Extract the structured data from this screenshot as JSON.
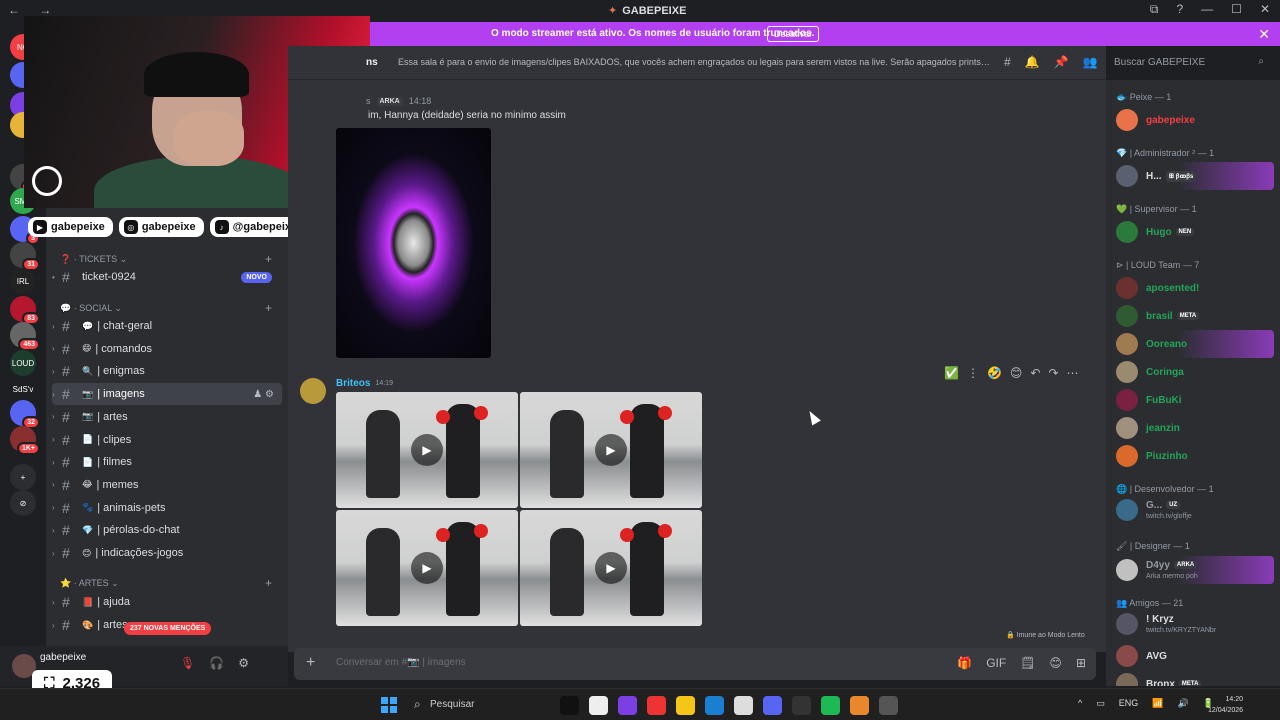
{
  "window": {
    "title": "GABEPEIXE",
    "controls": [
      "⧉",
      "?",
      "—",
      "☐",
      "✕"
    ],
    "nav": "← →"
  },
  "banner": {
    "text": "O modo streamer está ativo. Os nomes de usuário foram truncados.",
    "button": "Desativar",
    "close": "✕"
  },
  "rail": {
    "servers": [
      {
        "label": "NO",
        "badge": ""
      },
      {
        "label": "",
        "badge": "1"
      },
      {
        "label": "",
        "badge": "2"
      },
      {
        "label": "",
        "badge": ""
      },
      {
        "label": "",
        "badge": "4K"
      },
      {
        "label": "SMP",
        "badge": ""
      },
      {
        "label": "",
        "badge": "3"
      },
      {
        "label": "",
        "badge": "31"
      },
      {
        "label": "IRL",
        "badge": ""
      },
      {
        "label": "",
        "badge": "83"
      },
      {
        "label": "",
        "badge": "463"
      },
      {
        "label": "LOUD",
        "badge": ""
      },
      {
        "label": "SdS'v",
        "badge": ""
      },
      {
        "label": "",
        "badge": "32"
      },
      {
        "label": "",
        "badge": "1K+"
      },
      {
        "label": "+",
        "badge": ""
      },
      {
        "label": "⊘",
        "badge": ""
      }
    ]
  },
  "socials": [
    {
      "icon": "▶",
      "label": "gabepeixe"
    },
    {
      "icon": "◎",
      "label": "gabepeixe"
    },
    {
      "icon": "♪",
      "label": "@gabepeixes2"
    }
  ],
  "sidebar": {
    "categories": [
      {
        "label": "TICKETS",
        "emoji": "❓"
      },
      {
        "label": "SOCIAL",
        "emoji": "💬"
      },
      {
        "label": "ARTES",
        "emoji": "⭐"
      }
    ],
    "channels": [
      {
        "emoji": "",
        "name": "ticket-0924",
        "tag": "NOVO"
      },
      {
        "emoji": "💬",
        "name": "| chat-geral",
        "tag": ""
      },
      {
        "emoji": "😄",
        "name": "| comandos",
        "tag": ""
      },
      {
        "emoji": "🔍",
        "name": "| enigmas",
        "tag": ""
      },
      {
        "emoji": "📷",
        "name": "| imagens",
        "tag": ""
      },
      {
        "emoji": "📷",
        "name": "| artes",
        "tag": ""
      },
      {
        "emoji": "📄",
        "name": "| clipes",
        "tag": ""
      },
      {
        "emoji": "📄",
        "name": "| filmes",
        "tag": ""
      },
      {
        "emoji": "😂",
        "name": "| memes",
        "tag": ""
      },
      {
        "emoji": "🐾",
        "name": "| animais-pets",
        "tag": ""
      },
      {
        "emoji": "💎",
        "name": "| pérolas-do-chat",
        "tag": ""
      },
      {
        "emoji": "😊",
        "name": "| indicações-jogos",
        "tag": ""
      },
      {
        "emoji": "📕",
        "name": "| ajuda",
        "tag": ""
      },
      {
        "emoji": "🎨",
        "name": "| artes",
        "tag": ""
      }
    ],
    "mentions": "237 NOVAS MENÇÕES",
    "tools": "♟ ⚙"
  },
  "user": {
    "name": "gabepeixe",
    "points": "2.326",
    "icons": [
      "🎙",
      "🎧",
      "⚙"
    ]
  },
  "chathead": {
    "channel": "ns",
    "topic": "Essa sala é para o envio de imagens/clipes BAIXADOS, que vocês achem engraçados ou legais para serem vistos na live. Serão apagados prints de o...",
    "icons": [
      "#",
      "🔔",
      "📌",
      "👥"
    ]
  },
  "search": {
    "placeholder": "Buscar GABEPEIXE",
    "icon": "⌕"
  },
  "messages": {
    "m1": {
      "author": "s",
      "tag": "ARKA",
      "time": "14:18",
      "text": "im, Hannya (deidade) seria no minimo assim"
    },
    "m2": {
      "author": "Briteos",
      "time": "14:19"
    },
    "hover_tools": [
      "✅",
      "⋮",
      "🤣",
      "😊",
      "↶",
      "↷",
      "⋯"
    ],
    "play": "▶"
  },
  "slowmode": "🔒 Imune ao Modo Lento",
  "input": {
    "placeholder": "Conversar em #📷 | imagens",
    "icons": [
      "🎁",
      "GIF",
      "🗒",
      "😊",
      "⊞"
    ]
  },
  "members": {
    "groups": [
      {
        "label": "🐟 Peixe — 1"
      },
      {
        "label": "💎 | Administrador ² — 1"
      },
      {
        "label": "💚 | Supervisor — 1"
      },
      {
        "label": "⊳ | LOUD Team — 7"
      },
      {
        "label": "🌐 | Desenvolvedor — 1"
      },
      {
        "label": "🖌 | Designer — 1"
      },
      {
        "label": "👥 Amigos — 21"
      }
    ],
    "people": [
      {
        "name": "gabepeixe",
        "color": "#f23f43",
        "tag": "",
        "status": ""
      },
      {
        "name": "H...",
        "color": "#dbdee1",
        "tag": "ꕥ ꞵꝏꞵs",
        "status": ""
      },
      {
        "name": "Hugo",
        "color": "#23a55a",
        "tag": "NEN",
        "status": ""
      },
      {
        "name": "aposented!",
        "color": "#23a55a",
        "tag": "",
        "status": ""
      },
      {
        "name": "brasil",
        "color": "#23a55a",
        "tag": "META",
        "status": ""
      },
      {
        "name": "Ooreano",
        "color": "#23a55a",
        "tag": "",
        "status": ""
      },
      {
        "name": "Coringa",
        "color": "#23a55a",
        "tag": "",
        "status": ""
      },
      {
        "name": "FuBuKi",
        "color": "#23a55a",
        "tag": "",
        "status": ""
      },
      {
        "name": "jeanzin",
        "color": "#23a55a",
        "tag": "",
        "status": ""
      },
      {
        "name": "Piuzinho",
        "color": "#23a55a",
        "tag": "",
        "status": ""
      },
      {
        "name": "G...",
        "color": "#949ba4",
        "tag": "UZ",
        "status": "twitch.tv/gloffje"
      },
      {
        "name": "D4yy",
        "color": "#949ba4",
        "tag": "ARKA",
        "status": "Arka mermo poh"
      },
      {
        "name": "! Kryz",
        "color": "#dbdee1",
        "tag": "",
        "status": "twitch.tv/KRYZTYANbr"
      },
      {
        "name": "AVG",
        "color": "#dbdee1",
        "tag": "",
        "status": ""
      },
      {
        "name": "Bronx",
        "color": "#dbdee1",
        "tag": "META",
        "status": ""
      }
    ]
  },
  "taskbar": {
    "search": "Pesquisar",
    "tray": [
      "^",
      "▭",
      "ENG",
      "📶",
      "🔊",
      "🔋"
    ],
    "time": "14:20",
    "date": "12/04/2026",
    "app_colors": [
      "#111",
      "#eee",
      "#7b3fe4",
      "#e33",
      "#f5c518",
      "#1b7fd1",
      "#ddd",
      "#5865f2",
      "#333",
      "#1db954",
      "#e8872b",
      "#555"
    ]
  }
}
